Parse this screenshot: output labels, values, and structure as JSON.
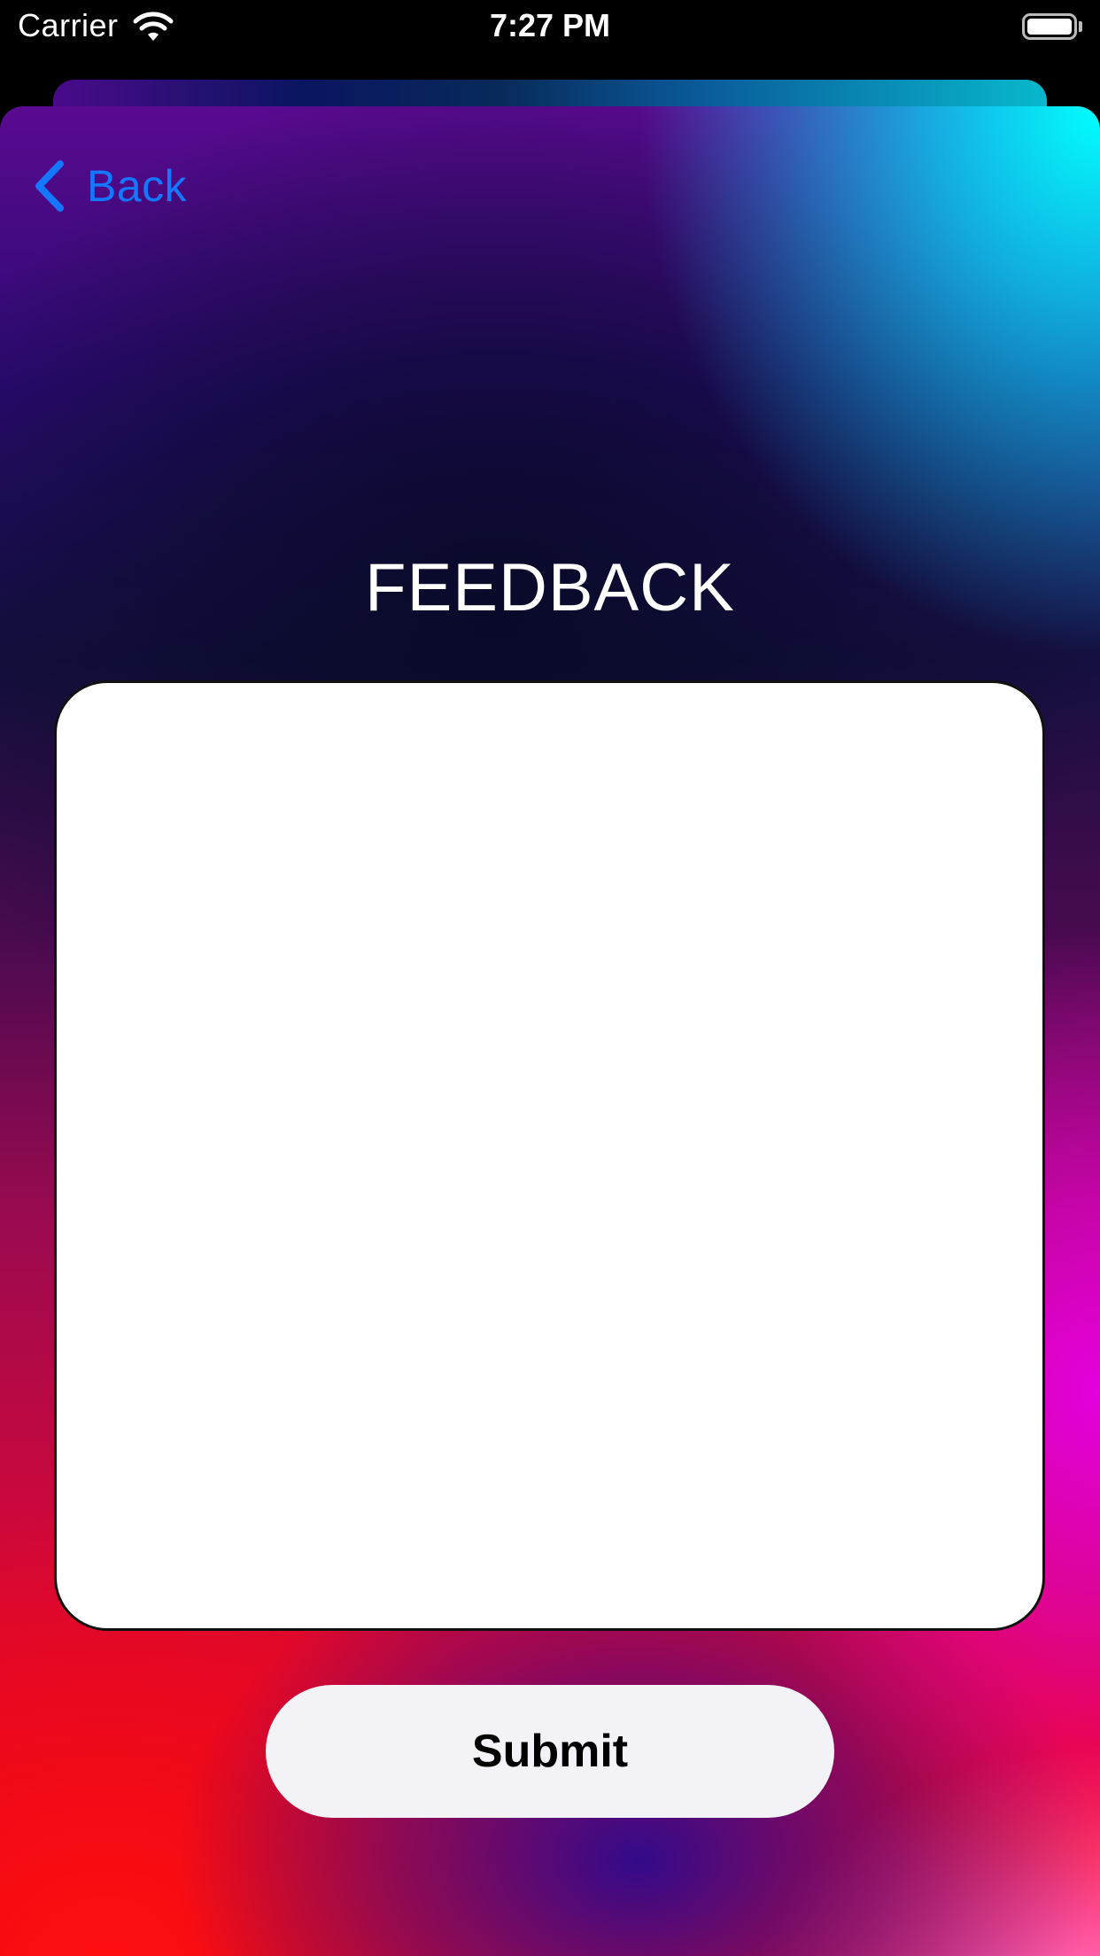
{
  "status_bar": {
    "carrier": "Carrier",
    "time": "7:27 PM",
    "icons": [
      "wifi-icon",
      "battery-icon"
    ]
  },
  "nav": {
    "back_label": "Back",
    "back_icon": "chevron-left-icon",
    "accent_color": "#1478ff"
  },
  "page": {
    "title": "FEEDBACK"
  },
  "feedback_input": {
    "value": "",
    "placeholder": ""
  },
  "submit": {
    "label": "Submit"
  }
}
